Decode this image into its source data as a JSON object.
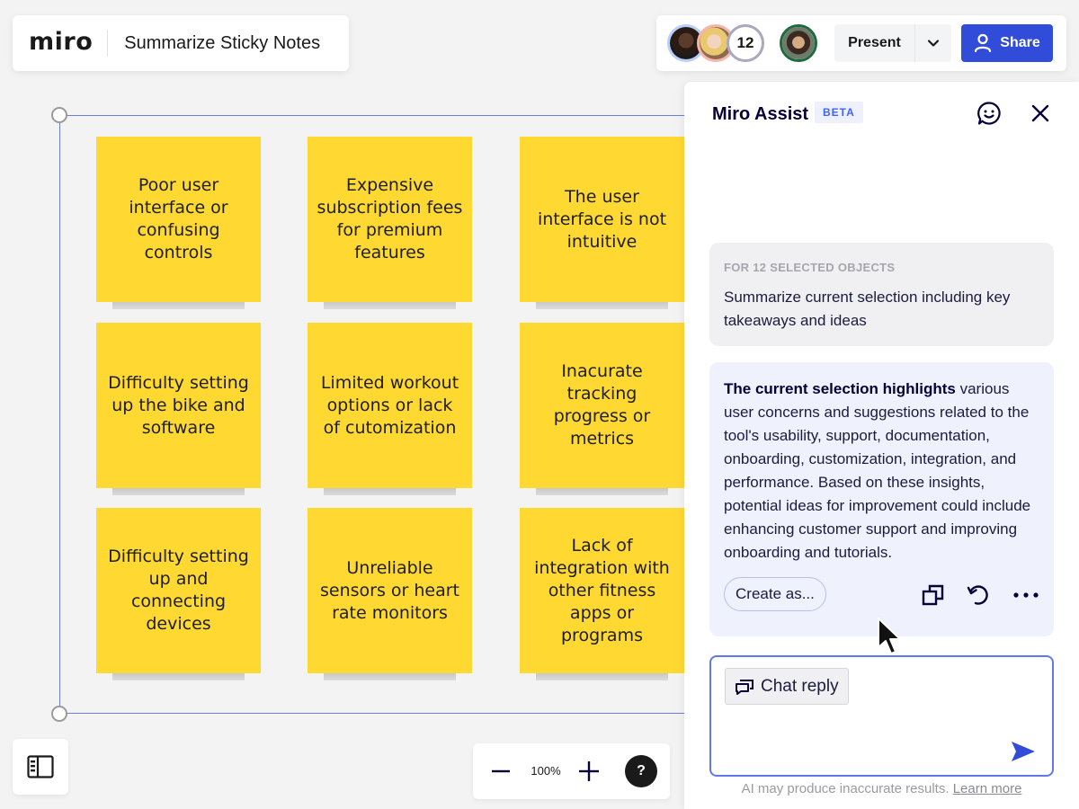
{
  "header": {
    "logo": "miro",
    "board_title": "Summarize Sticky Notes"
  },
  "collaborators": {
    "extra_count": "12",
    "present_label": "Present",
    "share_label": "Share",
    "share_color": "#314cd9"
  },
  "canvas": {
    "sticky_color": "#ffd932",
    "stickies": [
      {
        "text": "Poor user interface or confusing controls"
      },
      {
        "text": "Expensive subscription fees for premium features"
      },
      {
        "text": "The user interface is not intuitive"
      },
      {
        "text": "Difficulty setting up the bike and software"
      },
      {
        "text": "Limited workout options or lack of cutomization"
      },
      {
        "text": "Inacurate tracking progress or metrics"
      },
      {
        "text": "Difficulty setting up and connecting devices"
      },
      {
        "text": "Unreliable sensors or heart rate monitors"
      },
      {
        "text": "Lack of integration with other fitness apps or programs"
      }
    ]
  },
  "assist": {
    "title": "Miro Assist",
    "badge": "BETA",
    "prompt": {
      "label": "FOR 12 SELECTED OBJECTS",
      "text": "Summarize current selection including key takeaways and ideas"
    },
    "response": {
      "bold_lead": "The current selection highlights",
      "text": " various user concerns and suggestions related to the tool's usability, support, documentation, onboarding, customization, integration, and performance. Based on these insights, potential ideas for improvement could include enhancing customer support and improving onboarding and tutorials.",
      "create_label": "Create as..."
    },
    "chat": {
      "chip_label": "Chat reply"
    },
    "disclaimer": "AI may produce inaccurate results.",
    "learn_more": "Learn more"
  },
  "zoom": {
    "level": "100%",
    "help": "?"
  }
}
